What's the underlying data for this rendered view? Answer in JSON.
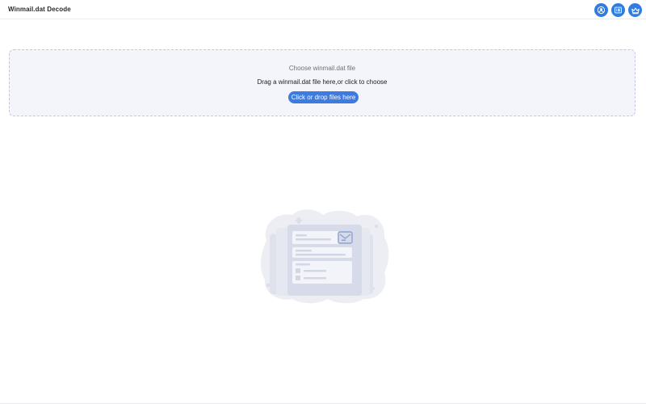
{
  "app": {
    "title": "Winmail.dat Decode"
  },
  "header": {
    "buttons": [
      {
        "icon": "user-icon"
      },
      {
        "icon": "list-icon"
      },
      {
        "icon": "crown-icon"
      }
    ],
    "accent": "#2f7de1"
  },
  "dropzone": {
    "heading": "Choose winmail.dat file",
    "hint": "Drag a winmail.dat file here,or click to choose",
    "button_label": "Click or drop files here",
    "button_color": "#3d7be0",
    "background": "#f4f5fa",
    "border_color": "#c3c6e6"
  },
  "empty_state": {
    "illustration": "empty-mailbox-illustration"
  }
}
